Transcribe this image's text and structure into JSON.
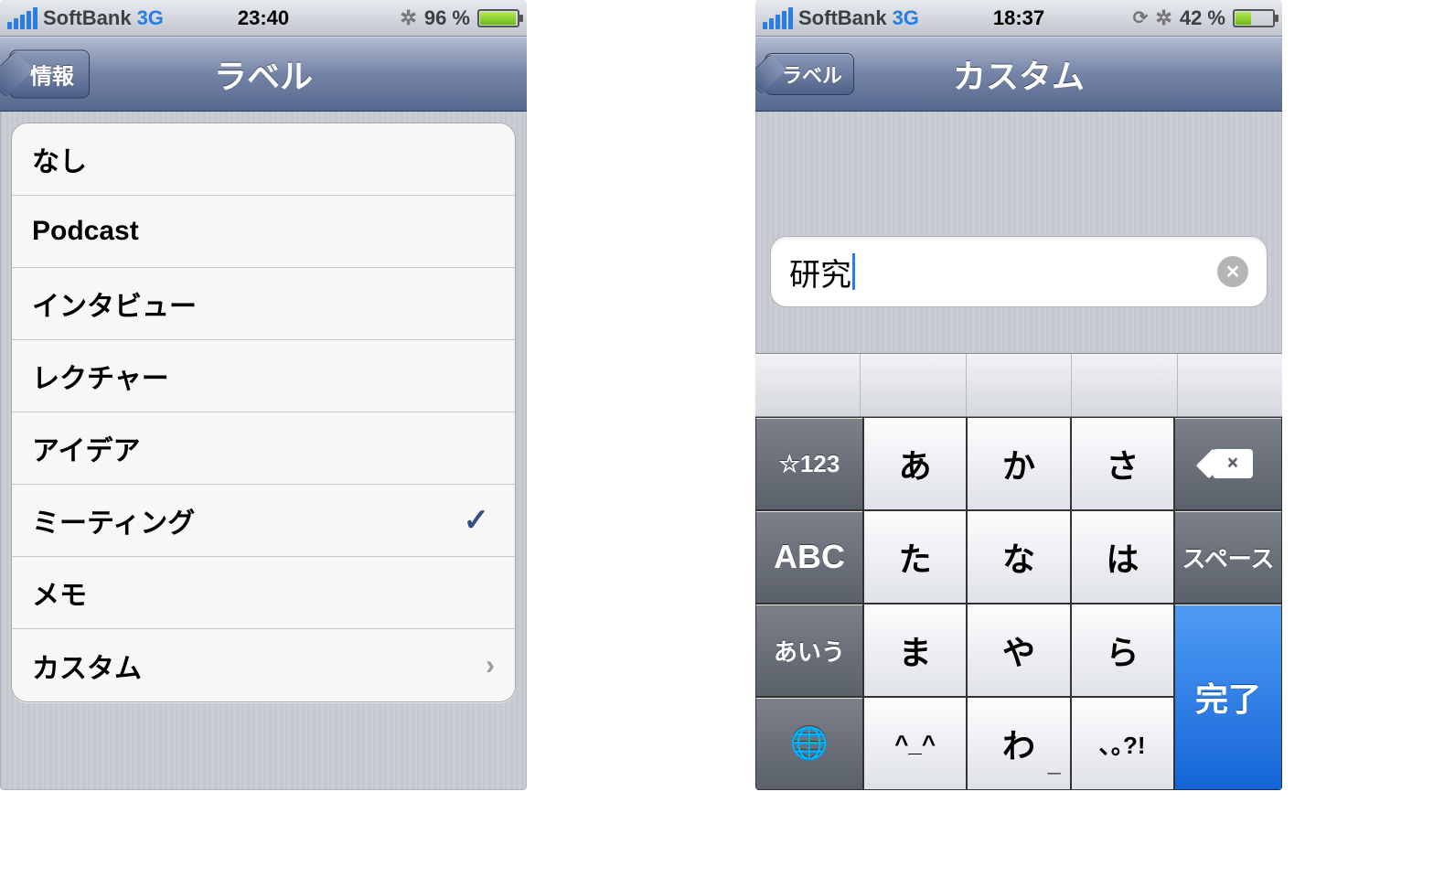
{
  "left": {
    "status": {
      "carrier": "SoftBank",
      "network": "3G",
      "time": "23:40",
      "battery_pct": "96 %"
    },
    "nav": {
      "back": "情報",
      "title": "ラベル"
    },
    "labels": {
      "none": "なし",
      "podcast": "Podcast",
      "interview": "インタビュー",
      "lecture": "レクチャー",
      "idea": "アイデア",
      "meeting": "ミーティング",
      "memo": "メモ",
      "custom": "カスタム"
    }
  },
  "right": {
    "status": {
      "carrier": "SoftBank",
      "network": "3G",
      "time": "18:37",
      "battery_pct": "42 %"
    },
    "nav": {
      "back": "ラベル",
      "title": "カスタム"
    },
    "input": {
      "value": "研究"
    },
    "keyboard": {
      "side": {
        "numsym": "☆123",
        "abc": "ABC",
        "kana": "あいう",
        "space": "スペース",
        "done": "完了"
      },
      "rows": [
        [
          "あ",
          "か",
          "さ"
        ],
        [
          "た",
          "な",
          "は"
        ],
        [
          "ま",
          "や",
          "ら"
        ],
        [
          "^_^",
          "わ",
          "､｡?!"
        ]
      ],
      "subs": {
        "wa": "ー"
      }
    }
  }
}
